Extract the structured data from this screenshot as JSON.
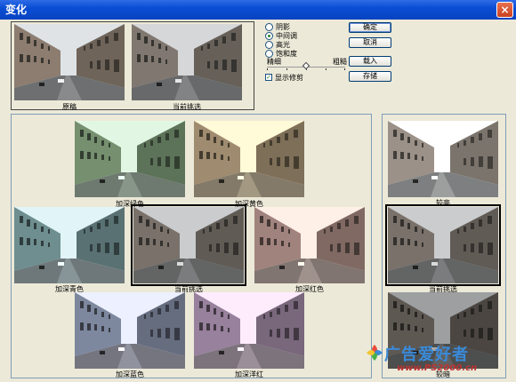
{
  "window": {
    "title": "变化",
    "close_glyph": "×"
  },
  "original_caption": "原稿",
  "current_pick_caption": "当前挑选",
  "channels": [
    {
      "label": "阴影",
      "selected": false
    },
    {
      "label": "中间调",
      "selected": true
    },
    {
      "label": "高光",
      "selected": false
    },
    {
      "label": "饱和度",
      "selected": false
    }
  ],
  "slider": {
    "left_label": "精细",
    "right_label": "粗糙",
    "level": 0.5
  },
  "show_clipping": {
    "label": "显示修剪",
    "checked": true
  },
  "buttons": {
    "ok": "确定",
    "cancel": "取消",
    "load": "载入",
    "save": "存储"
  },
  "color_variations": {
    "more_green": "加深绿色",
    "more_yellow": "加深黄色",
    "more_cyan": "加深青色",
    "current_pick": "当前挑选",
    "more_red": "加深红色",
    "more_blue": "加深蓝色",
    "more_magenta": "加深洋红"
  },
  "brightness": {
    "lighter": "较亮",
    "current_pick": "当前挑选",
    "darker": "较暗"
  },
  "watermark": {
    "text": "广告爱好者",
    "url": "www.PS2000.cn"
  },
  "colors": {
    "titlebar": "#0a4ed4",
    "dialog_bg": "#ece9d8"
  }
}
